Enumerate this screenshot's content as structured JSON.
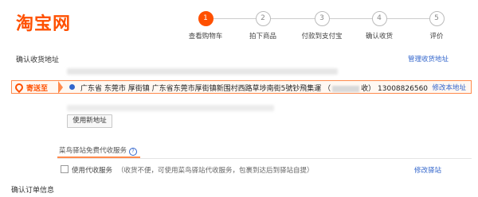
{
  "logo": "淘宝网",
  "steps": [
    {
      "num": "1",
      "label": "查看购物车",
      "active": true
    },
    {
      "num": "2",
      "label": "拍下商品",
      "active": false
    },
    {
      "num": "3",
      "label": "付款到支付宝",
      "active": false
    },
    {
      "num": "4",
      "label": "确认收货",
      "active": false
    },
    {
      "num": "5",
      "label": "评价",
      "active": false
    }
  ],
  "address_section": {
    "title": "确认收货地址",
    "manage_link": "管理收货地址"
  },
  "selected_address": {
    "send_to_label": "寄送至",
    "text_before_name": "广东省 东莞市 厚街镇 广东省东莞市厚街镇新围村西路草埗南街5號钞飛集運 （",
    "text_after_name": "收） 13008826560",
    "modify_link": "修改本地址"
  },
  "new_address_button": "使用新地址",
  "service_tab": {
    "label": "菜鸟驿站免费代收服务",
    "help_icon": "?"
  },
  "agent_service": {
    "checkbox_label": "使用代收服务",
    "note": "（收货不便，可使用菜鸟驿站代收服务，包裹到达后到驿站自提）",
    "modify_station_link": "修改驿站"
  },
  "confirm_order_title": "确认订单信息",
  "colors": {
    "accent": "#ff5000",
    "link": "#3366cc"
  }
}
